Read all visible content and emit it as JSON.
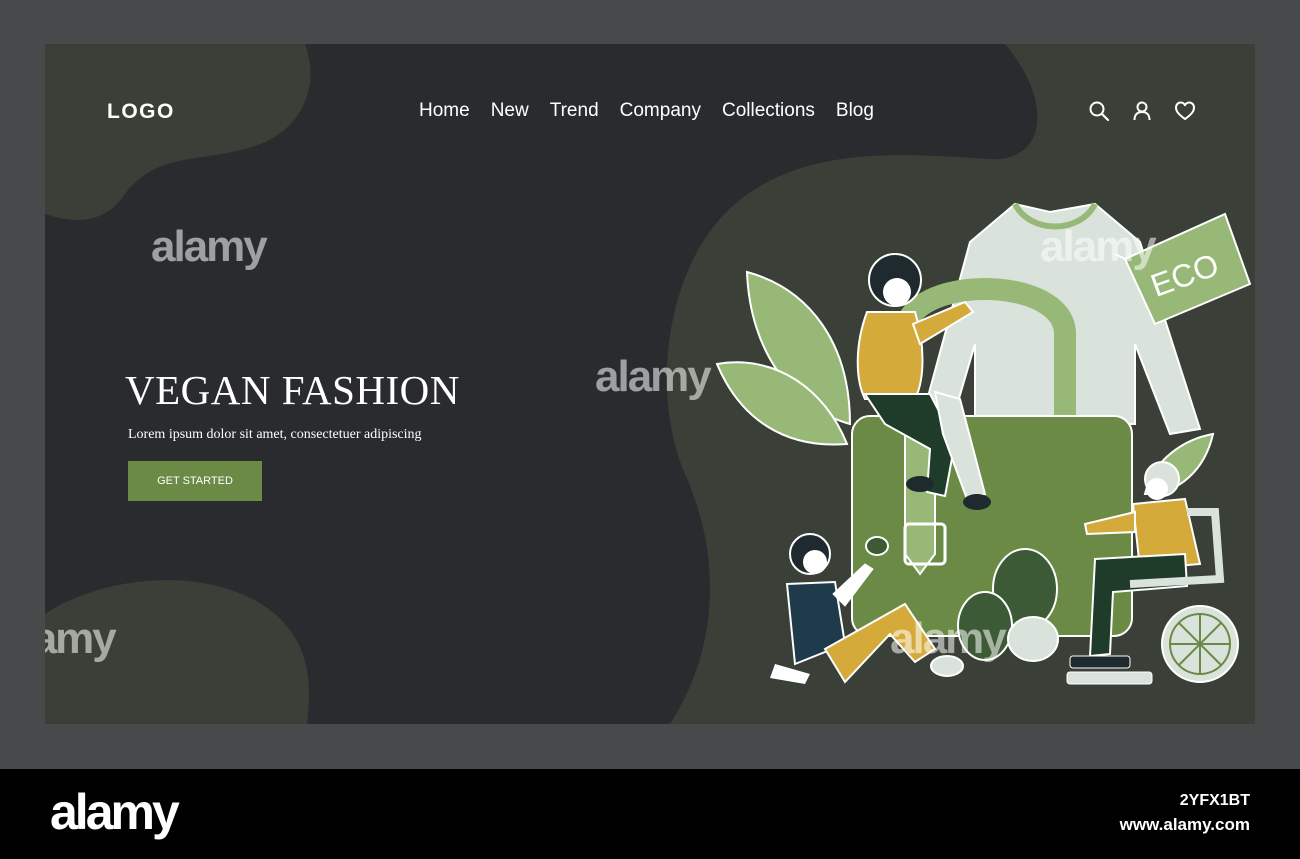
{
  "header": {
    "logo": "LOGO",
    "nav": [
      "Home",
      "New",
      "Trend",
      "Company",
      "Collections",
      "Blog"
    ],
    "icons": [
      "search-icon",
      "user-icon",
      "heart-icon"
    ]
  },
  "hero": {
    "title": "VEGAN FASHION",
    "subtitle": "Lorem ipsum dolor sit amet, consectetuer adipiscing",
    "cta_label": "GET STARTED"
  },
  "illustration": {
    "tag_text": "ECO"
  },
  "watermark": {
    "text": "alamy",
    "image_id": "2YFX1BT",
    "url": "www.alamy.com"
  },
  "colors": {
    "page_background": "#292b2f",
    "frame": "#464a4b",
    "blob": "#3a3f37",
    "accent_green": "#6b8a46",
    "light_green": "#98b878",
    "mustard": "#d4aa3a",
    "shirt": "#d9e3dc"
  }
}
